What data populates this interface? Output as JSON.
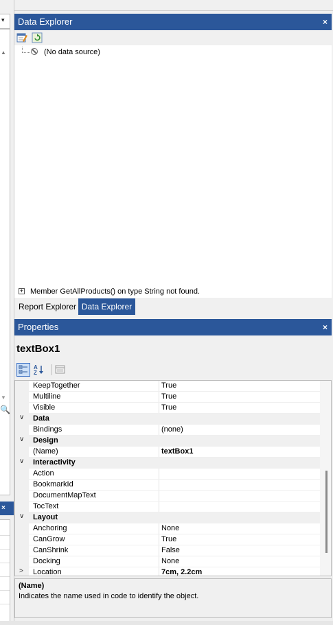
{
  "data_explorer": {
    "title": "Data Explorer",
    "close_glyph": "×",
    "toolbar": [
      {
        "icon": "edit-datasource-icon"
      },
      {
        "icon": "refresh-icon"
      }
    ],
    "tree": [
      {
        "label": "(No data source)",
        "icon": "no-data-icon"
      }
    ],
    "message": "Member GetAllProducts() on type String not found."
  },
  "tabs": [
    {
      "label": "Report Explorer",
      "active": false
    },
    {
      "label": "Data Explorer",
      "active": true
    }
  ],
  "properties": {
    "title": "Properties",
    "close_glyph": "×",
    "object_name": "textBox1",
    "toolbar": [
      {
        "icon": "categorized-icon",
        "active": true
      },
      {
        "icon": "alphabetical-icon",
        "active": false
      },
      {
        "icon": "property-pages-icon",
        "active": false
      }
    ],
    "rows": [
      {
        "type": "prop",
        "name": "KeepTogether",
        "value": "True"
      },
      {
        "type": "prop",
        "name": "Multiline",
        "value": "True"
      },
      {
        "type": "prop",
        "name": "Visible",
        "value": "True"
      },
      {
        "type": "category",
        "name": "Data",
        "chevron": "∨"
      },
      {
        "type": "prop",
        "name": "Bindings",
        "value": "(none)"
      },
      {
        "type": "category",
        "name": "Design",
        "chevron": "∨"
      },
      {
        "type": "prop",
        "name": "(Name)",
        "value": "textBox1",
        "bold": true
      },
      {
        "type": "category",
        "name": "Interactivity",
        "chevron": "∨"
      },
      {
        "type": "prop",
        "name": "Action",
        "value": ""
      },
      {
        "type": "prop",
        "name": "BookmarkId",
        "value": ""
      },
      {
        "type": "prop",
        "name": "DocumentMapText",
        "value": ""
      },
      {
        "type": "prop",
        "name": "TocText",
        "value": ""
      },
      {
        "type": "category",
        "name": "Layout",
        "chevron": "∨"
      },
      {
        "type": "prop",
        "name": "Anchoring",
        "value": "None"
      },
      {
        "type": "prop",
        "name": "CanGrow",
        "value": "True"
      },
      {
        "type": "prop",
        "name": "CanShrink",
        "value": "False"
      },
      {
        "type": "prop",
        "name": "Docking",
        "value": "None"
      },
      {
        "type": "prop",
        "name": "Location",
        "value": "7cm, 2.2cm",
        "bold": true,
        "chevron": ">"
      }
    ],
    "description": {
      "title": "(Name)",
      "text": "Indicates the name used in code to identify the object."
    }
  },
  "left_strip": {
    "dropdown_glyph": "▾",
    "close_glyph": "×"
  },
  "colors": {
    "header_blue": "#2b579a",
    "panel_bg": "#f0f0f0"
  }
}
